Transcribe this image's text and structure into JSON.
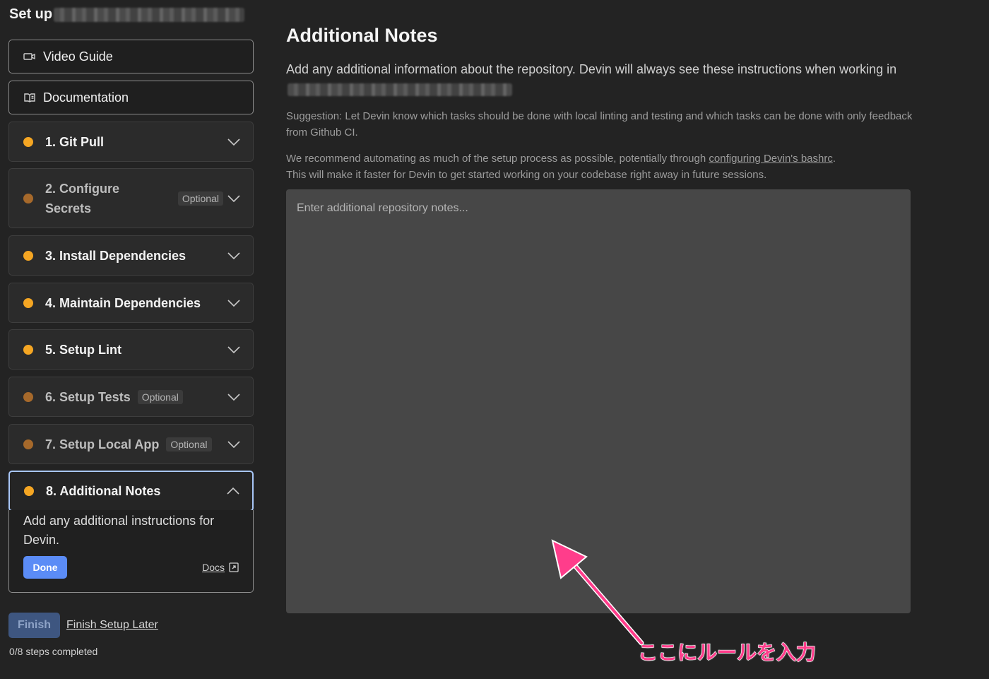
{
  "sidebar": {
    "title": "Set up",
    "video_guide": "Video Guide",
    "documentation": "Documentation",
    "steps": [
      {
        "label": "1. Git Pull",
        "optional": false
      },
      {
        "label": "2. Configure Secrets",
        "optional": true
      },
      {
        "label": "3. Install Dependencies",
        "optional": false
      },
      {
        "label": "4. Maintain Dependencies",
        "optional": false
      },
      {
        "label": "5. Setup Lint",
        "optional": false
      },
      {
        "label": "6. Setup Tests",
        "optional": true
      },
      {
        "label": "7. Setup Local App",
        "optional": true
      },
      {
        "label": "8. Additional Notes",
        "optional": false,
        "expanded": true
      }
    ],
    "optional_badge": "Optional",
    "active_panel": {
      "text": "Add any additional instructions for Devin.",
      "done_label": "Done",
      "docs_label": "Docs"
    },
    "finish_label": "Finish",
    "finish_later_label": "Finish Setup Later",
    "steps_completed": "0/8 steps completed"
  },
  "main": {
    "title": "Additional Notes",
    "description_prefix": "Add any additional information about the repository. Devin will always see these instructions when working in",
    "suggestion": "Suggestion: Let Devin know which tasks should be done with local linting and testing and which tasks can be done with only feedback from Github CI.",
    "recommend_prefix": "We recommend automating as much of the setup process as possible, potentially through",
    "recommend_link": "configuring Devin's bashrc",
    "recommend_suffix": ".",
    "recommend_line2": "This will make it faster for Devin to get started working on your codebase right away in future sessions.",
    "notes_value": "",
    "notes_placeholder": "Enter additional repository notes..."
  },
  "annotation": {
    "text": "ここにルールを入力",
    "color": "#ff3d8b"
  },
  "colors": {
    "required_dot": "#f5a623",
    "optional_dot": "#a6692b",
    "accent": "#5b8cf6",
    "active_border": "#a8c6f7"
  }
}
